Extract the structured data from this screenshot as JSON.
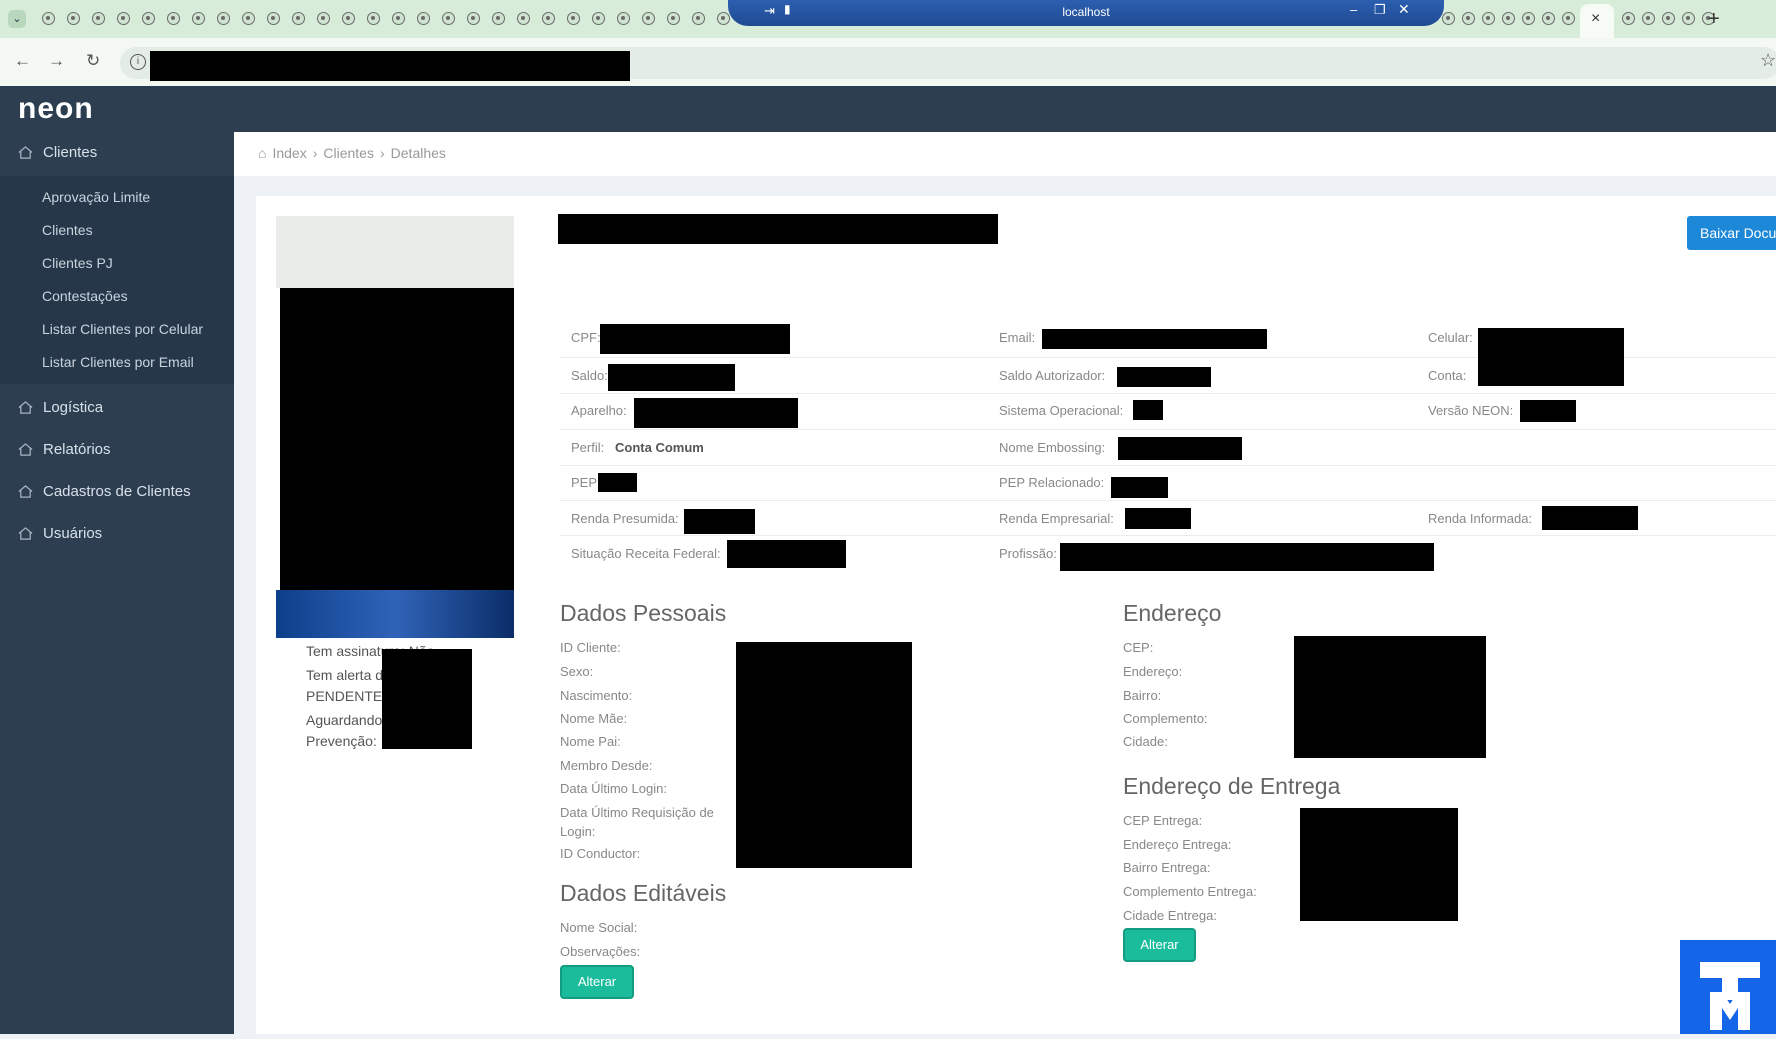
{
  "browser": {
    "window_title": "localhost",
    "new_tab_symbol": "+",
    "close_tab_symbol": "×",
    "tab_count_left": 28,
    "tab_count_right": 13
  },
  "app": {
    "logo": "neon"
  },
  "sidebar": {
    "items": [
      {
        "label": "Clientes",
        "icon": "home-icon"
      },
      {
        "label": "Logística",
        "icon": "home-icon"
      },
      {
        "label": "Relatórios",
        "icon": "home-icon"
      },
      {
        "label": "Cadastros de Clientes",
        "icon": "home-icon"
      },
      {
        "label": "Usuários",
        "icon": "home-icon"
      }
    ],
    "submenu": [
      "Aprovação Limite",
      "Clientes",
      "Clientes PJ",
      "Contestações",
      "Listar Clientes por Celular",
      "Listar Clientes por Email"
    ]
  },
  "breadcrumb": [
    "Index",
    "Clientes",
    "Detalhes"
  ],
  "download_button": "Baixar Docu",
  "fields": {
    "cpf": "CPF:",
    "email": "Email:",
    "celular": "Celular:",
    "saldo": "Saldo:",
    "saldo_autorizador": "Saldo Autorizador:",
    "conta": "Conta:",
    "aparelho": "Aparelho:",
    "sistema_operacional": "Sistema Operacional:",
    "versao_neon": "Versão NEON:",
    "perfil": "Perfil:",
    "perfil_value": "Conta Comum",
    "nome_embossing": "Nome Embossing:",
    "pep": "PEP:",
    "pep_relacionado": "PEP Relacionado:",
    "renda_presumida": "Renda Presumida:",
    "renda_empresarial": "Renda Empresarial:",
    "renda_informada": "Renda Informada:",
    "situacao_receita": "Situação Receita Federal:",
    "profissao": "Profissão:"
  },
  "left_column": {
    "tem_assinatura": "Tem assinatura: Não",
    "tem_alerta": "Tem alerta d",
    "pendente": "PENDENTE:",
    "aguardando": "Aguardando",
    "prevencao": "Prevenção:"
  },
  "dados_pessoais": {
    "title": "Dados Pessoais",
    "labels": [
      "ID Cliente:",
      "Sexo:",
      "Nascimento:",
      "Nome Mãe:",
      "Nome Pai:",
      "Membro Desde:",
      "Data Último Login:",
      "Data Último Requisição de",
      "Login:",
      "ID Conductor:"
    ]
  },
  "dados_editaveis": {
    "title": "Dados Editáveis",
    "labels": [
      "Nome Social:",
      "Observações:"
    ],
    "button": "Alterar"
  },
  "endereco": {
    "title": "Endereço",
    "labels": [
      "CEP:",
      "Endereço:",
      "Bairro:",
      "Complemento:",
      "Cidade:"
    ]
  },
  "endereco_entrega": {
    "title": "Endereço de Entrega",
    "labels": [
      "CEP Entrega:",
      "Endereço Entrega:",
      "Bairro Entrega:",
      "Complemento Entrega:",
      "Cidade Entrega:"
    ],
    "button": "Alterar"
  }
}
